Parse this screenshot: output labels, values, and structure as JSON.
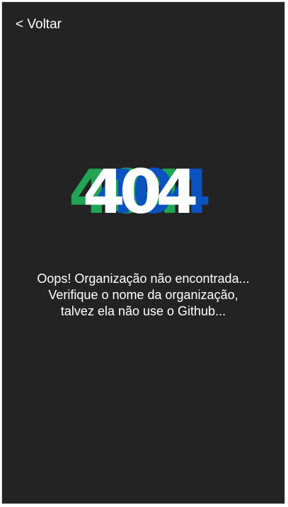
{
  "nav": {
    "back_label": "< Voltar"
  },
  "error": {
    "code": "404",
    "colors": {
      "green": "#21a453",
      "blue": "#0b52be",
      "front": "#ffffff"
    }
  },
  "message": {
    "lines": [
      "Oops! Organização não encontrada...",
      "Verifique o nome da organização,",
      "talvez ela não use o Github..."
    ]
  }
}
